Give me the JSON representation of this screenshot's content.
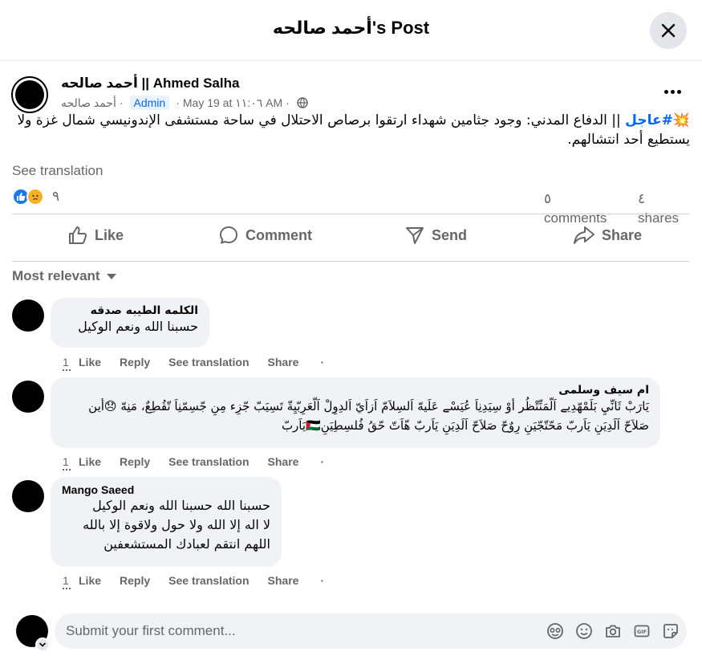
{
  "header": {
    "title": "أحمد صالحه's Post"
  },
  "post": {
    "author": "أحمد صالحه || Ahmed Salha",
    "meta": {
      "arabic_name": "أحمد صالحه",
      "role_badge": "Admin",
      "date": "May 19 at ١١:٠٦ AM"
    },
    "text": {
      "prefix_emoji": "💥",
      "hashtag": "#عاجل",
      "body": " || الدفاع المدني: وجود جثامين شهداء ارتقوا برصاص الاحتلال في ساحة مستشفى الإندونيسي شمال غزة ولا يستطيع أحد انتشالهم."
    },
    "see_translation": "See translation",
    "reaction_count": "٩",
    "comments_count": "٥",
    "comments_label": "comments",
    "shares_count": "٤",
    "shares_label": "shares"
  },
  "actions": {
    "like": "Like",
    "comment": "Comment",
    "send": "Send",
    "share": "Share"
  },
  "sort": {
    "label": "Most relevant"
  },
  "comments": [
    {
      "name": "الكلمه الطيبه صدقه",
      "text": "حسبنا الله ونعم الوكيل",
      "count": "1",
      "like": "Like",
      "reply": "Reply",
      "translate": "See translation",
      "share": "Share",
      "dot": "·"
    },
    {
      "name": "ام سيف وسلمى",
      "text": "يَارَبْ ثَانِّيِ بَلَمْهّدِيے اَلّمَنِّتْظُر أوْ سِيَدِنِاَ عُيَسْے عَلَيهّ اَلسِلاَمّ اَزاَيّ اَلدِوِلْ اَلّعَرِبّيِةّ تَسِيَبّ جّزِء مِنِ جّسِمّنِاَ تّقُطِعٌ، مَنِهّ 😞أين صَلاَحّ اَلَدِيَنِ يَاَربّ مَحّتّجّيَنِ رِوٌحّ صَلاَحّ اَلَدِيَنِ يَاَربّ هّاَتّ حّقُ فُلسِطِيَنِ🇵🇸يَاَربّ",
      "count": "1",
      "like": "Like",
      "reply": "Reply",
      "translate": "See translation",
      "share": "Share",
      "dot": "·"
    },
    {
      "name": "Mango Saeed",
      "text_lines": [
        "حسبنا الله حسبنا الله ونعم الوكيل",
        "لا اله إلا الله ولا حول ولاقوة إلا بالله",
        "اللهم انتقم لعبادك المستشعفين"
      ],
      "count": "1",
      "like": "Like",
      "reply": "Reply",
      "translate": "See translation",
      "share": "Share",
      "dot": "·"
    }
  ],
  "composer": {
    "placeholder": "Submit your first comment..."
  }
}
